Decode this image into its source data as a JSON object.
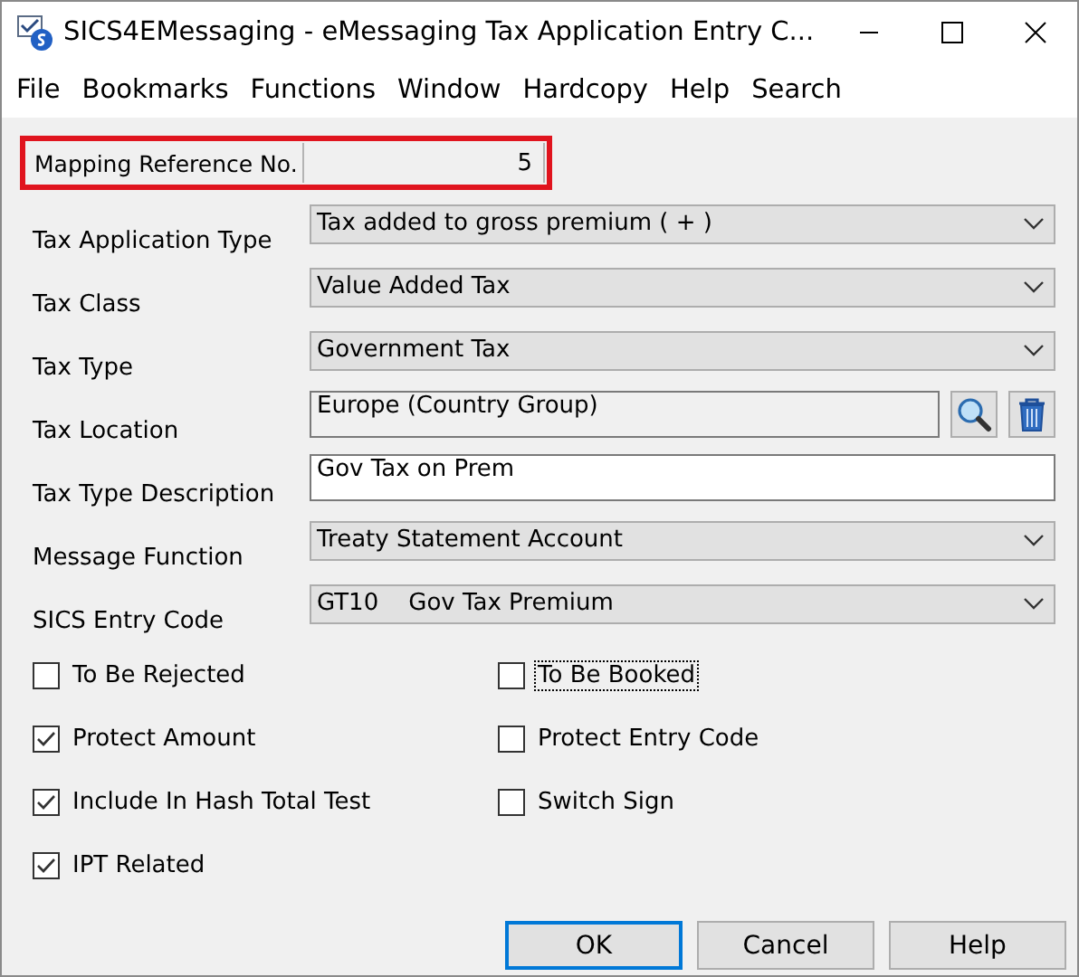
{
  "window": {
    "title": "SICS4EMessaging - eMessaging Tax Application Entry C..."
  },
  "menu": [
    {
      "label": "File"
    },
    {
      "label": "Bookmarks"
    },
    {
      "label": "Functions"
    },
    {
      "label": "Window"
    },
    {
      "label": "Hardcopy"
    },
    {
      "label": "Help"
    },
    {
      "label": "Search"
    }
  ],
  "mapping": {
    "label": "Mapping Reference No.",
    "value": "5",
    "highlighted": true
  },
  "fields": [
    {
      "label": "Tax Application Type",
      "kind": "combo",
      "value": "Tax added to gross premium ( + )"
    },
    {
      "label": "Tax Class",
      "kind": "combo",
      "value": "Value Added Tax"
    },
    {
      "label": "Tax Type",
      "kind": "combo",
      "value": "Government Tax"
    },
    {
      "label": "Tax Location",
      "kind": "lookup",
      "value": "Europe (Country Group)"
    },
    {
      "label": "Tax Type Description",
      "kind": "text",
      "value": "Gov Tax on Prem"
    },
    {
      "label": "Message Function",
      "kind": "combo",
      "value": "Treaty Statement Account"
    },
    {
      "label": "SICS Entry Code",
      "kind": "combo",
      "value": "GT10    Gov Tax Premium"
    }
  ],
  "checkboxes": [
    {
      "label": "To Be Rejected",
      "checked": false,
      "focused": false
    },
    {
      "label": "To Be Booked",
      "checked": false,
      "focused": true
    },
    {
      "label": "Protect Amount",
      "checked": true,
      "focused": false
    },
    {
      "label": "Protect Entry Code",
      "checked": false,
      "focused": false
    },
    {
      "label": "Include In Hash Total Test",
      "checked": true,
      "focused": false
    },
    {
      "label": "Switch Sign",
      "checked": false,
      "focused": false
    },
    {
      "label": "IPT Related",
      "checked": true,
      "focused": false
    }
  ],
  "buttons": [
    {
      "label": "OK",
      "default": true
    },
    {
      "label": "Cancel",
      "default": false
    },
    {
      "label": "Help",
      "default": false
    }
  ]
}
